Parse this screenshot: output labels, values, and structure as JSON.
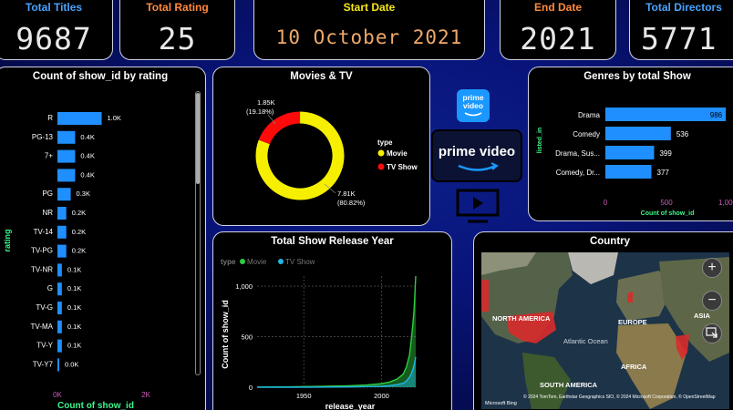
{
  "kpis": {
    "total_titles": {
      "label": "Total Titles",
      "value": "9687",
      "color": "#4aa3ff"
    },
    "total_rating": {
      "label": "Total Rating",
      "value": "25",
      "color": "#ff8a3d"
    },
    "start_date": {
      "label": "Start Date",
      "value": "10 October 2021",
      "color": "#f6e716"
    },
    "end_date": {
      "label": "End Date",
      "value": "2021",
      "color": "#ff8a3d"
    },
    "total_directors": {
      "label": "Total Directors",
      "value": "5771",
      "color": "#4aa3ff"
    }
  },
  "rating_panel": {
    "title": "Count of show_id by rating"
  },
  "movies_tv_panel": {
    "title": "Movies & TV"
  },
  "genres_panel": {
    "title": "Genres by total Show"
  },
  "release_panel": {
    "title": "Total Show Release Year"
  },
  "country_panel": {
    "title": "Country"
  },
  "prime_logo": {
    "small": "prime video",
    "large": "prime video"
  },
  "map": {
    "labels": {
      "north_america": "NORTH AMERICA",
      "europe": "EUROPE",
      "asia": "ASIA",
      "atlantic": "Atlantic Ocean",
      "africa": "AFRICA",
      "south_america": "SOUTH AMERICA"
    },
    "credits": "© 2024 TomTom, Earthstar Geographics SIO, © 2024 Microsoft Corporation, © OpenStreetMap",
    "bing": "Microsoft Bing",
    "zoom_in": "+",
    "zoom_out": "−"
  },
  "chart_data": [
    {
      "id": "rating",
      "type": "bar",
      "orientation": "horizontal",
      "title": "Count of show_id by rating",
      "xlabel": "Count of show_id",
      "ylabel": "rating",
      "categories": [
        "R",
        "PG-13",
        "7+",
        "",
        "PG",
        "NR",
        "TV-14",
        "TV-PG",
        "TV-NR",
        "G",
        "TV-G",
        "TV-MA",
        "TV-Y",
        "TV-Y7"
      ],
      "values": [
        1000,
        400,
        400,
        400,
        300,
        200,
        200,
        200,
        100,
        100,
        100,
        100,
        100,
        0
      ],
      "data_labels": [
        "1.0K",
        "0.4K",
        "0.4K",
        "0.4K",
        "0.3K",
        "0.2K",
        "0.2K",
        "0.2K",
        "0.1K",
        "0.1K",
        "0.1K",
        "0.1K",
        "0.1K",
        "0.0K"
      ],
      "xticks": [
        "0K",
        "2K"
      ],
      "xlim": [
        0,
        2000
      ],
      "color": "#1f8fff"
    },
    {
      "id": "movies_tv",
      "type": "pie",
      "title": "Movies & TV",
      "legend_title": "type",
      "slices": [
        {
          "name": "Movie",
          "value": 7810,
          "label": "7.81K",
          "percent": "(80.82%)",
          "color": "#f6f000"
        },
        {
          "name": "TV Show",
          "value": 1850,
          "label": "1.85K",
          "percent": "(19.18%)",
          "color": "#ff0a0a"
        }
      ]
    },
    {
      "id": "genres",
      "type": "bar",
      "orientation": "horizontal",
      "title": "Genres by total Show",
      "xlabel": "Count of show_id",
      "ylabel": "listed_in",
      "categories": [
        "Drama",
        "Comedy",
        "Drama, Sus...",
        "Comedy, Dr..."
      ],
      "values": [
        986,
        536,
        399,
        377
      ],
      "xticks": [
        "0",
        "500",
        "1,000"
      ],
      "xlim": [
        0,
        1000
      ],
      "color": "#1f8fff"
    },
    {
      "id": "release_year",
      "type": "area",
      "title": "Total Show Release Year",
      "xlabel": "release_year",
      "ylabel": "Count of show_id",
      "legend_title": "type",
      "legend_placement": "top-left",
      "ylim": [
        0,
        1100
      ],
      "yticks": [
        "0",
        "500",
        "1,000"
      ],
      "xticks": [
        "1950",
        "2000"
      ],
      "xlim": [
        1920,
        2022
      ],
      "series": [
        {
          "name": "Movie",
          "color": "#2ecc40",
          "x": [
            1920,
            1940,
            1960,
            1980,
            1990,
            2000,
            2005,
            2010,
            2014,
            2016,
            2018,
            2019,
            2020,
            2021,
            2022
          ],
          "y": [
            2,
            4,
            8,
            15,
            22,
            35,
            50,
            80,
            130,
            200,
            320,
            450,
            600,
            780,
            1100
          ]
        },
        {
          "name": "TV Show",
          "color": "#1fb5e8",
          "x": [
            1920,
            1940,
            1960,
            1980,
            1990,
            2000,
            2005,
            2010,
            2014,
            2016,
            2018,
            2019,
            2020,
            2021,
            2022
          ],
          "y": [
            0,
            0,
            1,
            3,
            6,
            10,
            15,
            25,
            40,
            60,
            100,
            130,
            170,
            220,
            300
          ]
        }
      ]
    }
  ]
}
